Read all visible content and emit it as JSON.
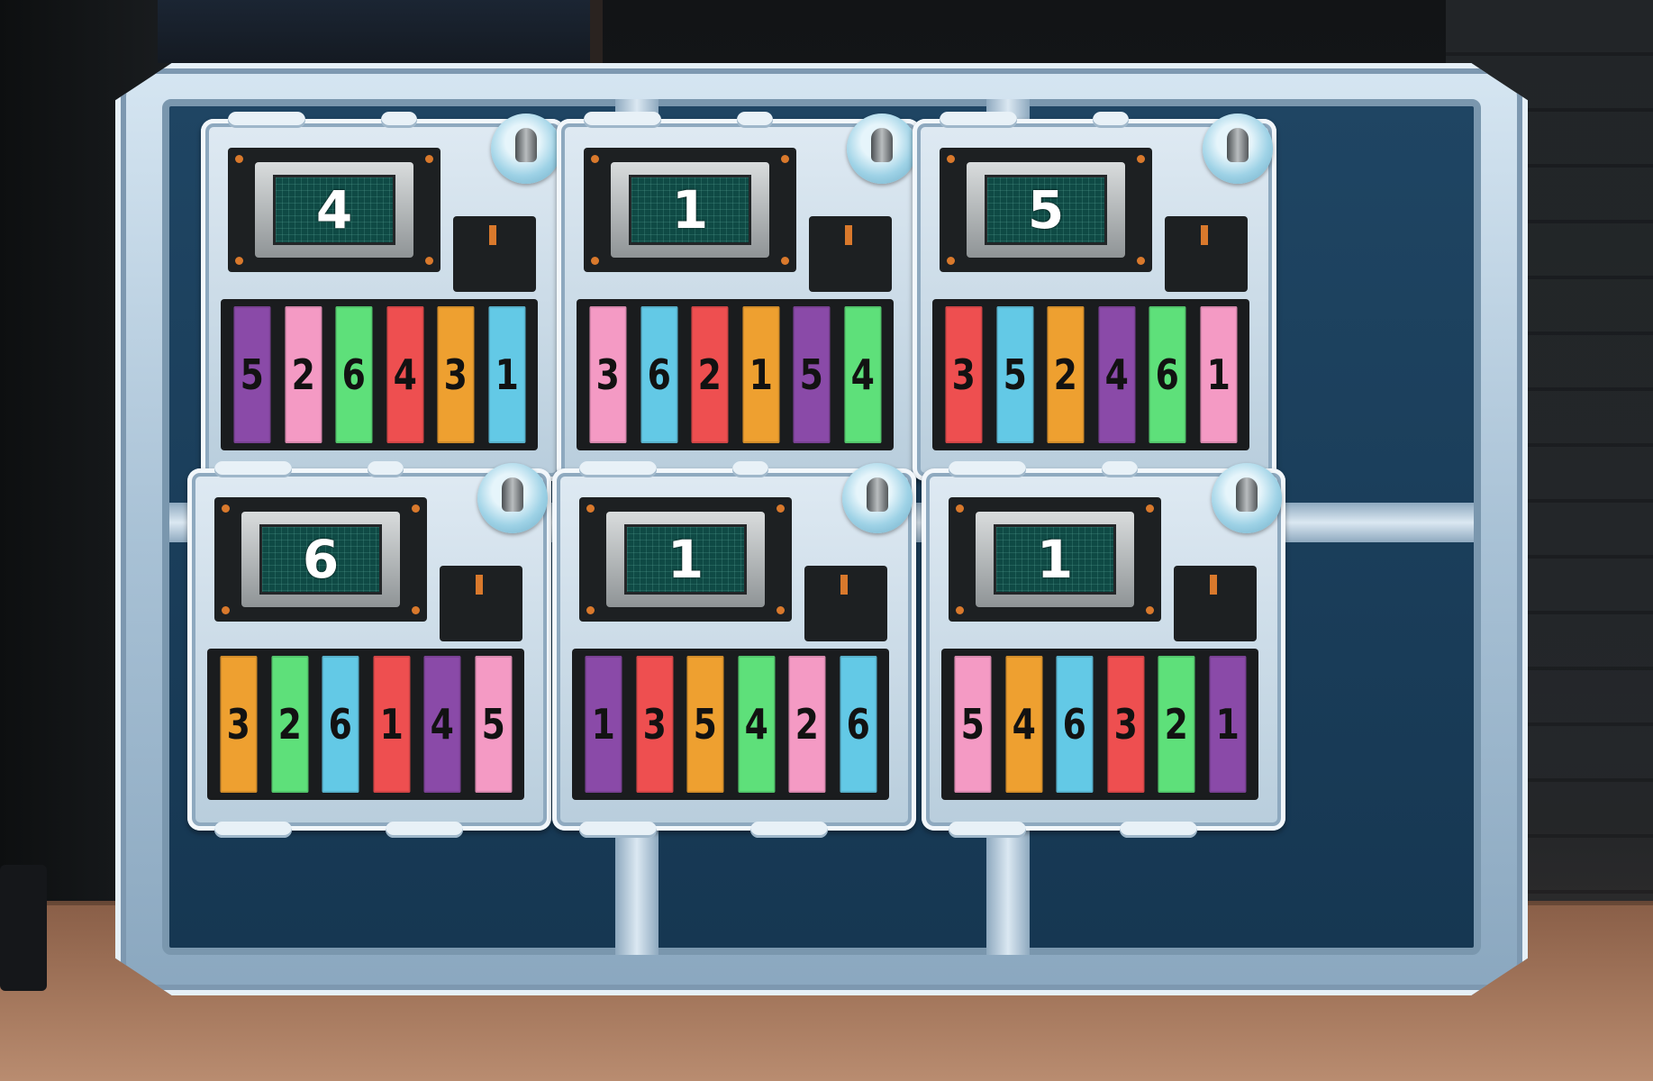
{
  "colors": {
    "purple": "#8a4aa8",
    "pink": "#f49ac4",
    "green": "#5ee07a",
    "red": "#ee4f50",
    "orange": "#eea030",
    "blue": "#63c9e6"
  },
  "modules": [
    {
      "display": "4",
      "keys": [
        {
          "label": "5",
          "color": "#8a4aa8"
        },
        {
          "label": "2",
          "color": "#f49ac4"
        },
        {
          "label": "6",
          "color": "#5ee07a"
        },
        {
          "label": "4",
          "color": "#ee4f50"
        },
        {
          "label": "3",
          "color": "#eea030"
        },
        {
          "label": "1",
          "color": "#63c9e6"
        }
      ]
    },
    {
      "display": "1",
      "keys": [
        {
          "label": "3",
          "color": "#f49ac4"
        },
        {
          "label": "6",
          "color": "#63c9e6"
        },
        {
          "label": "2",
          "color": "#ee4f50"
        },
        {
          "label": "1",
          "color": "#eea030"
        },
        {
          "label": "5",
          "color": "#8a4aa8"
        },
        {
          "label": "4",
          "color": "#5ee07a"
        }
      ]
    },
    {
      "display": "5",
      "keys": [
        {
          "label": "3",
          "color": "#ee4f50"
        },
        {
          "label": "5",
          "color": "#63c9e6"
        },
        {
          "label": "2",
          "color": "#eea030"
        },
        {
          "label": "4",
          "color": "#8a4aa8"
        },
        {
          "label": "6",
          "color": "#5ee07a"
        },
        {
          "label": "1",
          "color": "#f49ac4"
        }
      ]
    },
    {
      "display": "6",
      "keys": [
        {
          "label": "3",
          "color": "#eea030"
        },
        {
          "label": "2",
          "color": "#5ee07a"
        },
        {
          "label": "6",
          "color": "#63c9e6"
        },
        {
          "label": "1",
          "color": "#ee4f50"
        },
        {
          "label": "4",
          "color": "#8a4aa8"
        },
        {
          "label": "5",
          "color": "#f49ac4"
        }
      ]
    },
    {
      "display": "1",
      "keys": [
        {
          "label": "1",
          "color": "#8a4aa8"
        },
        {
          "label": "3",
          "color": "#ee4f50"
        },
        {
          "label": "5",
          "color": "#eea030"
        },
        {
          "label": "4",
          "color": "#5ee07a"
        },
        {
          "label": "2",
          "color": "#f49ac4"
        },
        {
          "label": "6",
          "color": "#63c9e6"
        }
      ]
    },
    {
      "display": "1",
      "keys": [
        {
          "label": "5",
          "color": "#f49ac4"
        },
        {
          "label": "4",
          "color": "#eea030"
        },
        {
          "label": "6",
          "color": "#63c9e6"
        },
        {
          "label": "3",
          "color": "#ee4f50"
        },
        {
          "label": "2",
          "color": "#5ee07a"
        },
        {
          "label": "1",
          "color": "#8a4aa8"
        }
      ]
    }
  ]
}
